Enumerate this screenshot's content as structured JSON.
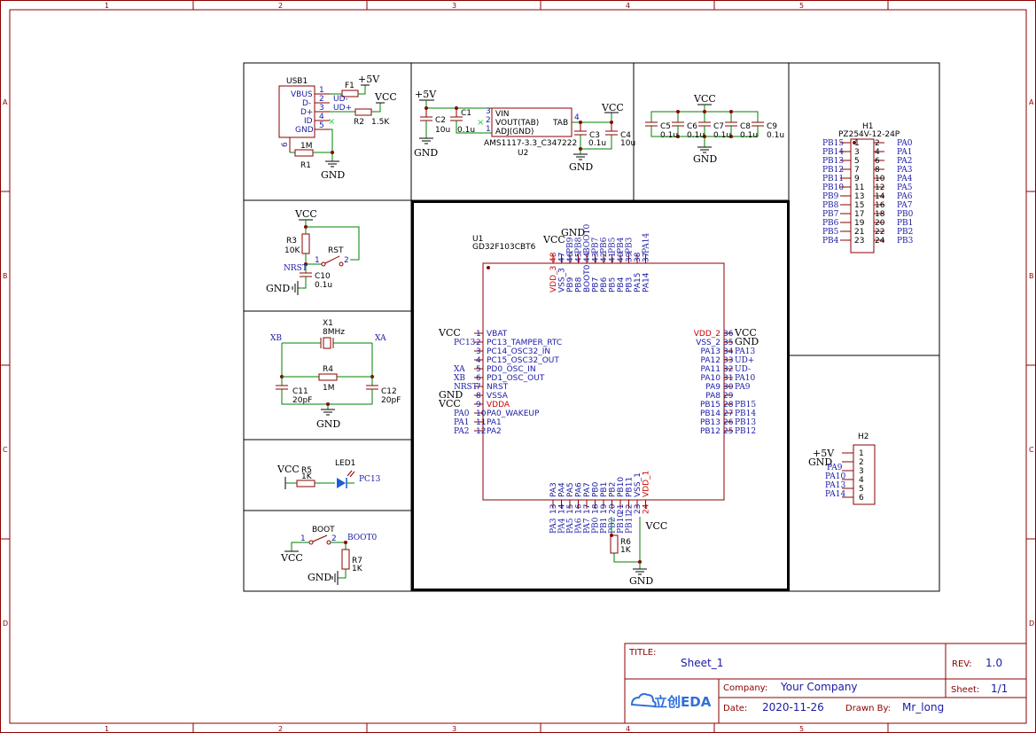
{
  "frame": {
    "cols": [
      "1",
      "2",
      "3",
      "4",
      "5"
    ],
    "rows": [
      "A",
      "B",
      "C",
      "D"
    ]
  },
  "title_block": {
    "title_label": "TITLE:",
    "title": "Sheet_1",
    "rev_label": "REV:",
    "rev": "1.0",
    "company_label": "Company:",
    "company": "Your Company",
    "sheet_label": "Sheet:",
    "sheet": "1/1",
    "date_label": "Date:",
    "date": "2020-11-26",
    "drawn_label": "Drawn By:",
    "drawn_by": "Mr_long",
    "logo": "立创EDA"
  },
  "usb": {
    "ref": "USB1",
    "pins": [
      "VBUS",
      "D-",
      "D+",
      "ID",
      "GND"
    ],
    "pin_nums": [
      "1",
      "2",
      "3",
      "4",
      "5",
      "6"
    ],
    "f1": "F1",
    "p5v": "+5V",
    "vcc": "VCC",
    "udm": "UD-",
    "udp": "UD+",
    "r2": "R2",
    "r2v": "1.5K",
    "r1v": "1M",
    "r1": "R1",
    "gnd": "GND"
  },
  "ldo": {
    "p5v": "+5V",
    "c2": "C2",
    "c2v": "10u",
    "c1": "C1",
    "c1v": "0.1u",
    "vin": "VIN",
    "vout": "VOUT(TAB)",
    "adj": "ADJ(GND)",
    "tab": "TAB",
    "pins": [
      "3",
      "2",
      "1",
      "4"
    ],
    "part": "AMS1117-3.3_C347222",
    "ref": "U2",
    "vcc": "VCC",
    "c3": "C3",
    "c3v": "0.1u",
    "c4": "C4",
    "c4v": "10u",
    "gnd": "GND",
    "gnd2": "GND"
  },
  "caps": {
    "vcc": "VCC",
    "gnd": "GND",
    "items": [
      [
        "C5",
        "0.1u"
      ],
      [
        "C6",
        "0.1u"
      ],
      [
        "C7",
        "0.1u"
      ],
      [
        "C8",
        "0.1u"
      ],
      [
        "C9",
        "0.1u"
      ]
    ]
  },
  "header": {
    "ref": "H1",
    "part": "PZ254V-12-24P",
    "left": [
      "PB15",
      "PB14",
      "PB13",
      "PB12",
      "PB11",
      "PB10",
      "PB9",
      "PB8",
      "PB7",
      "PB6",
      "PB5",
      "PB4"
    ],
    "right": [
      "PA0",
      "PA1",
      "PA2",
      "PA3",
      "PA4",
      "PA5",
      "PA6",
      "PA7",
      "PB0",
      "PB1",
      "PB2",
      "PB3"
    ],
    "odd": [
      "1",
      "3",
      "5",
      "7",
      "9",
      "11",
      "13",
      "15",
      "17",
      "19",
      "21",
      "23"
    ],
    "even": [
      "2",
      "4",
      "6",
      "8",
      "10",
      "12",
      "14",
      "16",
      "18",
      "20",
      "22",
      "24"
    ]
  },
  "reset": {
    "vcc": "VCC",
    "r3": "R3",
    "r3v": "10K",
    "rst": "RST",
    "nrst": "NRST",
    "p1": "1",
    "p2": "2",
    "c10": "C10",
    "c10v": "0.1u",
    "gnd": "GND"
  },
  "xtal": {
    "x1": "X1",
    "x1v": "8MHz",
    "xb": "XB",
    "xa": "XA",
    "r4": "R4",
    "r4v": "1M",
    "c11": "C11",
    "c11v": "20pF",
    "c12": "C12",
    "c12v": "20pF",
    "gnd": "GND"
  },
  "led": {
    "vcc": "VCC",
    "r5": "R5",
    "r5v": "1K",
    "led": "LED1",
    "pc13": "PC13"
  },
  "boot": {
    "boot": "BOOT",
    "p1": "1",
    "p2": "2",
    "boot0": "BOOT0",
    "vcc": "VCC",
    "r7": "R7",
    "r7v": "1K",
    "gnd": "GND"
  },
  "mcu": {
    "ref": "U1",
    "part": "GD32F103CBT6",
    "gnd": "GND",
    "vcc": "VCC",
    "gnd2": "GND",
    "top_pins": [
      [
        "48",
        "VDD_3",
        ""
      ],
      [
        "47",
        "VSS_3",
        ""
      ],
      [
        "46",
        "PB9",
        "PB9"
      ],
      [
        "45",
        "PB8",
        "PB8"
      ],
      [
        "44",
        "BOOT0",
        "BOOT0"
      ],
      [
        "43",
        "PB7",
        "PB7"
      ],
      [
        "42",
        "PB6",
        "PB6"
      ],
      [
        "41",
        "PB5",
        "PB5"
      ],
      [
        "40",
        "PB4",
        "PB4"
      ],
      [
        "39",
        "PB3",
        "PB3"
      ],
      [
        "38",
        "PA15",
        ""
      ],
      [
        "37",
        "PA14",
        "PA14"
      ]
    ],
    "left_pins": [
      [
        "1",
        "VBAT",
        "VCC"
      ],
      [
        "2",
        "PC13_TAMPER_RTC",
        "PC13"
      ],
      [
        "3",
        "PC14_OSC32_IN",
        ""
      ],
      [
        "4",
        "PC15_OSC32_OUT",
        ""
      ],
      [
        "5",
        "PD0_OSC_IN",
        "XA"
      ],
      [
        "6",
        "PD1_OSC_OUT",
        "XB"
      ],
      [
        "7",
        "NRST",
        "NRST"
      ],
      [
        "8",
        "VSSA",
        "GND"
      ],
      [
        "9",
        "VDDA",
        "VCC"
      ],
      [
        "10",
        "PA0_WAKEUP",
        "PA0"
      ],
      [
        "11",
        "PA1",
        "PA1"
      ],
      [
        "12",
        "PA2",
        "PA2"
      ]
    ],
    "right_pins": [
      [
        "36",
        "VDD_2",
        "VCC"
      ],
      [
        "35",
        "VSS_2",
        "GND"
      ],
      [
        "34",
        "PA13",
        "PA13"
      ],
      [
        "33",
        "PA12",
        "UD+"
      ],
      [
        "32",
        "PA11",
        "UD-"
      ],
      [
        "31",
        "PA10",
        "PA10"
      ],
      [
        "30",
        "PA9",
        "PA9"
      ],
      [
        "29",
        "PA8",
        ""
      ],
      [
        "28",
        "PB15",
        "PB15"
      ],
      [
        "27",
        "PB14",
        "PB14"
      ],
      [
        "26",
        "PB13",
        "PB13"
      ],
      [
        "25",
        "PB12",
        "PB12"
      ]
    ],
    "bottom_pins": [
      [
        "13",
        "PA3",
        "PA3"
      ],
      [
        "14",
        "PA4",
        "PA4"
      ],
      [
        "15",
        "PA5",
        "PA5"
      ],
      [
        "16",
        "PA6",
        "PA6"
      ],
      [
        "17",
        "PA7",
        "PA7"
      ],
      [
        "18",
        "PB0",
        "PB0"
      ],
      [
        "19",
        "PB1",
        "PB1"
      ],
      [
        "20",
        "PB2",
        "PB2"
      ],
      [
        "21",
        "PB10",
        "PB10"
      ],
      [
        "22",
        "PB11",
        "PB11"
      ],
      [
        "23",
        "VSS_1",
        ""
      ],
      [
        "24",
        "VDD_1",
        "VCC"
      ]
    ],
    "r6": "R6",
    "r6v": "1K",
    "gnd_b": "GND"
  },
  "swd": {
    "ref": "H2",
    "p5v": "+5V",
    "gnd": "GND",
    "labels": [
      "PA9",
      "PA10",
      "PA13",
      "PA14"
    ],
    "pins": [
      "1",
      "2",
      "3",
      "4",
      "5",
      "6"
    ]
  }
}
